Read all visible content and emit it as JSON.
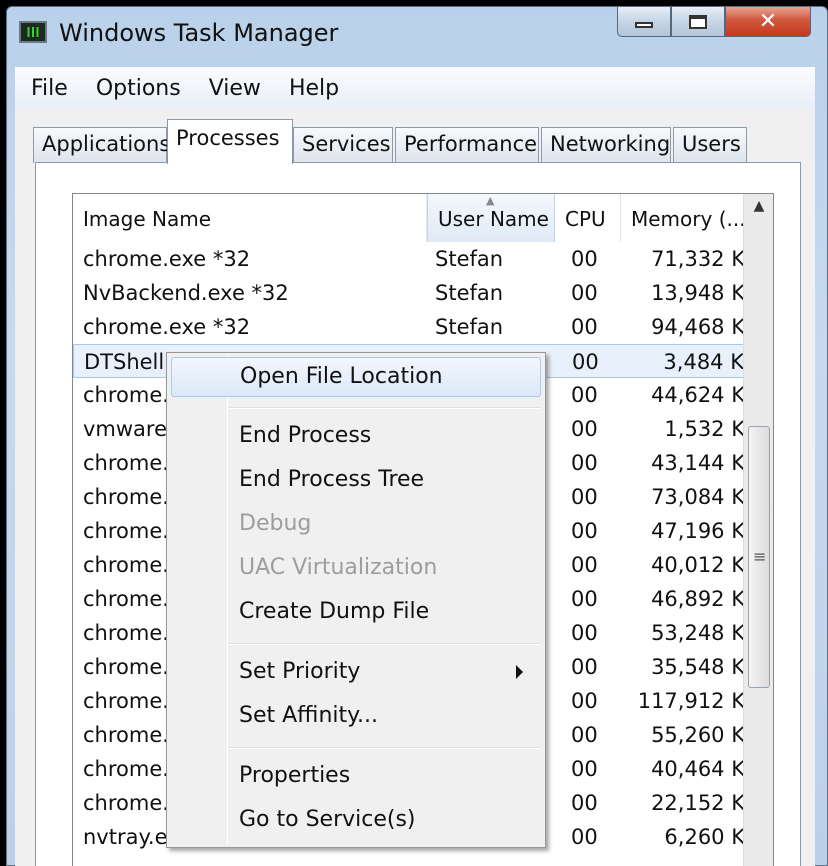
{
  "window": {
    "title": "Windows Task Manager"
  },
  "icons": {
    "app": "task-manager-icon",
    "minimize": "minimize-icon",
    "maximize": "maximize-icon",
    "close": "close-icon",
    "sort": "sort-ascending-icon",
    "submenu": "submenu-arrow-icon",
    "scroll_up": "scroll-up-icon",
    "scroll_grip": "scroll-grip-icon"
  },
  "menubar": [
    "File",
    "Options",
    "View",
    "Help"
  ],
  "tabs": [
    "Applications",
    "Processes",
    "Services",
    "Performance",
    "Networking",
    "Users"
  ],
  "active_tab": "Processes",
  "table": {
    "columns": [
      "Image Name",
      "User Name",
      "CPU",
      "Memory (..."
    ],
    "sorted_column": "User Name",
    "rows": [
      {
        "name": "chrome.exe *32",
        "user": "Stefan",
        "cpu": "00",
        "mem": "71,332 K"
      },
      {
        "name": "NvBackend.exe *32",
        "user": "Stefan",
        "cpu": "00",
        "mem": "13,948 K"
      },
      {
        "name": "chrome.exe *32",
        "user": "Stefan",
        "cpu": "00",
        "mem": "94,468 K"
      },
      {
        "name": "DTShellHlp",
        "user": "",
        "cpu": "00",
        "mem": "3,484 K"
      },
      {
        "name": "chrome.e",
        "user": "",
        "cpu": "00",
        "mem": "44,624 K"
      },
      {
        "name": "vmware-t",
        "user": "",
        "cpu": "00",
        "mem": "1,532 K"
      },
      {
        "name": "chrome.e",
        "user": "",
        "cpu": "00",
        "mem": "43,144 K"
      },
      {
        "name": "chrome.e",
        "user": "",
        "cpu": "00",
        "mem": "73,084 K"
      },
      {
        "name": "chrome.e",
        "user": "",
        "cpu": "00",
        "mem": "47,196 K"
      },
      {
        "name": "chrome.e",
        "user": "",
        "cpu": "00",
        "mem": "40,012 K"
      },
      {
        "name": "chrome.e",
        "user": "",
        "cpu": "00",
        "mem": "46,892 K"
      },
      {
        "name": "chrome.e",
        "user": "",
        "cpu": "00",
        "mem": "53,248 K"
      },
      {
        "name": "chrome.e",
        "user": "",
        "cpu": "00",
        "mem": "35,548 K"
      },
      {
        "name": "chrome.e",
        "user": "",
        "cpu": "00",
        "mem": "117,912 K"
      },
      {
        "name": "chrome.e",
        "user": "",
        "cpu": "00",
        "mem": "55,260 K"
      },
      {
        "name": "chrome.e",
        "user": "",
        "cpu": "00",
        "mem": "40,464 K"
      },
      {
        "name": "chrome.e",
        "user": "",
        "cpu": "00",
        "mem": "22,152 K"
      },
      {
        "name": "nvtray.ex",
        "user": "",
        "cpu": "00",
        "mem": "6,260 K"
      }
    ]
  },
  "context_menu": {
    "groups": [
      [
        {
          "label": "Open File Location",
          "state": "hover"
        }
      ],
      [
        {
          "label": "End Process"
        },
        {
          "label": "End Process Tree"
        },
        {
          "label": "Debug",
          "state": "disabled"
        },
        {
          "label": "UAC Virtualization",
          "state": "disabled"
        },
        {
          "label": "Create Dump File"
        }
      ],
      [
        {
          "label": "Set Priority",
          "submenu": true
        },
        {
          "label": "Set Affinity..."
        }
      ],
      [
        {
          "label": "Properties"
        },
        {
          "label": "Go to Service(s)"
        }
      ]
    ]
  }
}
